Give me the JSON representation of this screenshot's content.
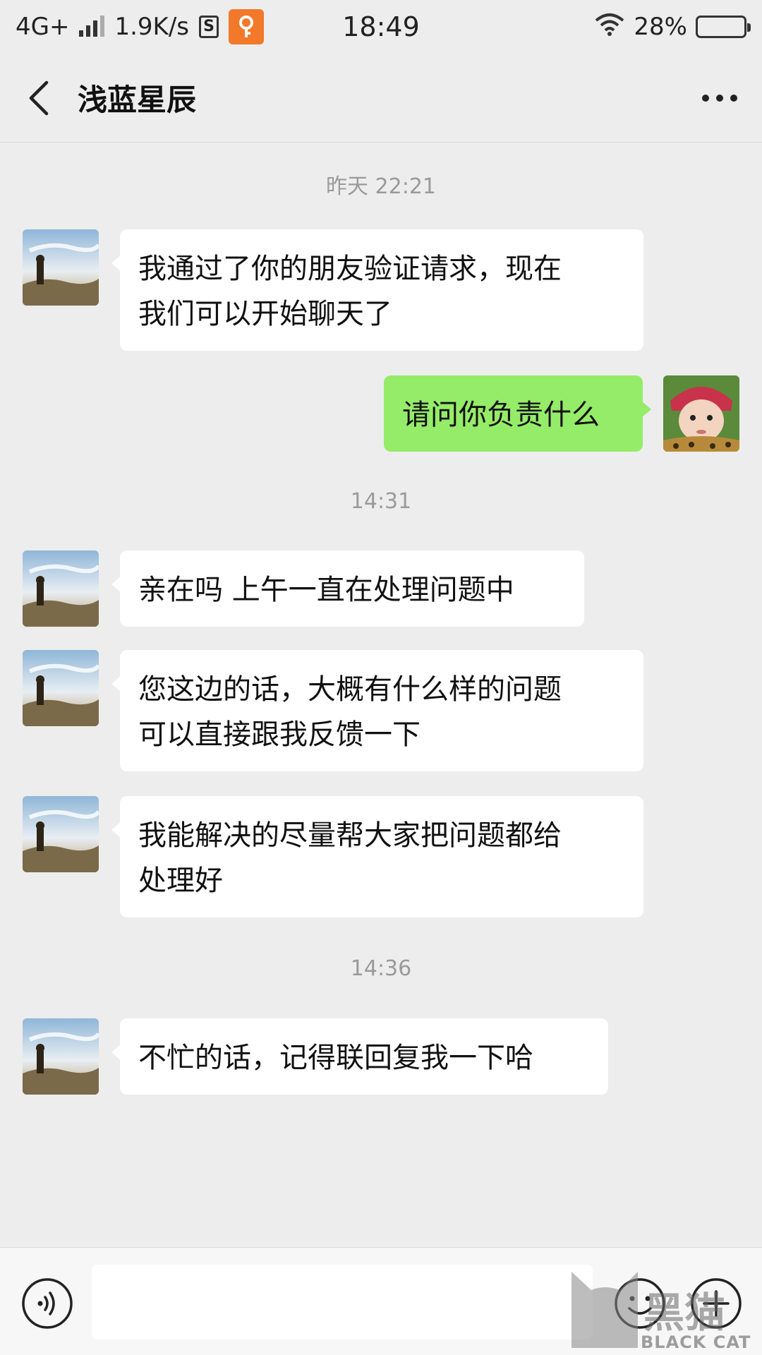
{
  "status_bar": {
    "network": "4G+",
    "speed": "1.9K/s",
    "time": "18:49",
    "battery_percent": "28%",
    "battery_level": 0.28
  },
  "header": {
    "title": "浅蓝星辰"
  },
  "messages": [
    {
      "type": "time",
      "text": "昨天 22:21"
    },
    {
      "type": "left",
      "text": "我通过了你的朋友验证请求，现在\n我们可以开始聊天了"
    },
    {
      "type": "right",
      "text": "请问你负责什么"
    },
    {
      "type": "time",
      "text": "14:31"
    },
    {
      "type": "left",
      "text": "亲在吗 上午一直在处理问题中"
    },
    {
      "type": "left",
      "text": "您这边的话，大概有什么样的问题\n可以直接跟我反馈一下"
    },
    {
      "type": "left",
      "text": "我能解决的尽量帮大家把问题都给\n处理好"
    },
    {
      "type": "time",
      "text": "14:36"
    },
    {
      "type": "left",
      "text": "不忙的话，记得联回复我一下哈"
    }
  ],
  "input": {
    "value": "",
    "placeholder": ""
  },
  "watermark": {
    "text": "BLACK CAT",
    "glyphs": "黑猫"
  },
  "colors": {
    "background": "#ededed",
    "my_bubble": "#95ec69",
    "other_bubble": "#ffffff",
    "app_icon": "#f2782a"
  },
  "icons": {
    "back": "chevron-left-icon",
    "more": "more-dots-icon",
    "voice": "voice-icon",
    "emoji": "emoji-icon",
    "plus": "plus-icon"
  }
}
